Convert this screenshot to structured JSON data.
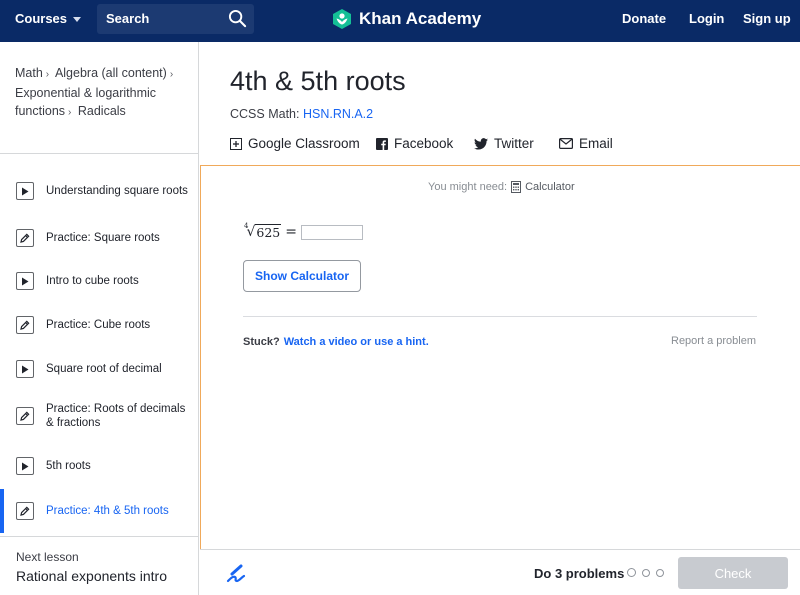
{
  "topnav": {
    "courses_label": "Courses",
    "search_label": "Search",
    "brand": "Khan Academy",
    "donate": "Donate",
    "login": "Login",
    "signup": "Sign up"
  },
  "breadcrumb": [
    {
      "label": "Math"
    },
    {
      "label": "Algebra (all content)"
    },
    {
      "label": "Exponential & logarithmic functions"
    },
    {
      "label": "Radicals"
    }
  ],
  "lessons": [
    {
      "label": "Understanding square roots",
      "type": "video"
    },
    {
      "label": "Practice: Square roots",
      "type": "practice"
    },
    {
      "label": "Intro to cube roots",
      "type": "video"
    },
    {
      "label": "Practice: Cube roots",
      "type": "practice"
    },
    {
      "label": "Square root of decimal",
      "type": "video"
    },
    {
      "label": "Practice: Roots of decimals & fractions",
      "type": "practice"
    },
    {
      "label": "5th roots",
      "type": "video"
    },
    {
      "label": "Practice: 4th & 5th roots",
      "type": "practice",
      "active": true
    }
  ],
  "next_lesson": {
    "label": "Next lesson",
    "value": "Rational exponents intro"
  },
  "page": {
    "title": "4th & 5th roots",
    "ccss_prefix": "CCSS Math:",
    "ccss_code": "HSN.RN.A.2"
  },
  "share": {
    "google": "Google Classroom",
    "facebook": "Facebook",
    "twitter": "Twitter",
    "email": "Email"
  },
  "exercise": {
    "need_prefix": "You might need:",
    "need_tool": "Calculator",
    "root_index": "4",
    "radicand": "625",
    "equals": "=",
    "answer_value": "",
    "show_calculator": "Show Calculator",
    "stuck": "Stuck?",
    "hint_link": "Watch a video or use a hint.",
    "report": "Report a problem"
  },
  "bottom": {
    "count": "Do 3 problems",
    "check": "Check"
  },
  "colors": {
    "nav_bg": "#0a2a66",
    "accent": "#1865f2",
    "exercise_border": "#f0a95a"
  }
}
